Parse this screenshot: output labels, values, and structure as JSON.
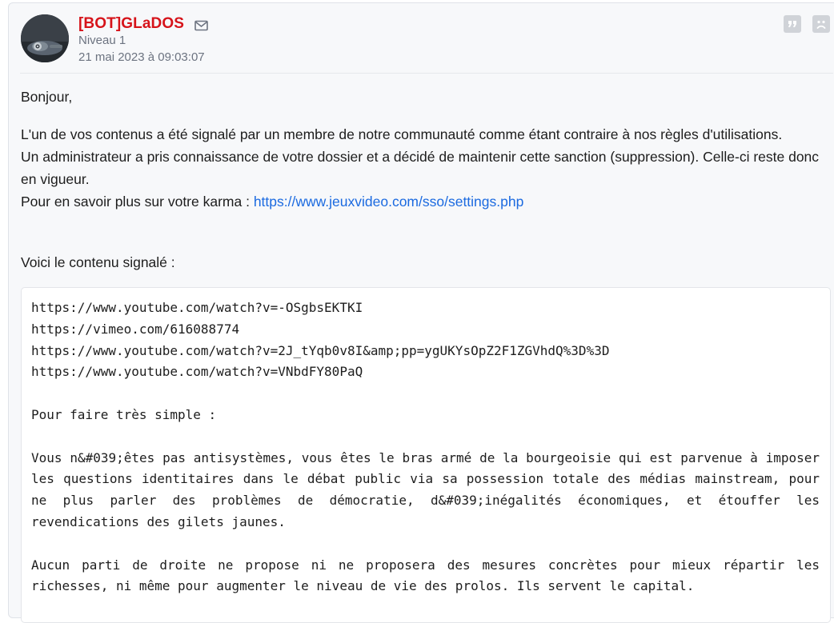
{
  "post": {
    "author": "[BOT]GLaDOS",
    "level": "Niveau 1",
    "date": "21 mai 2023 à 09:03:07",
    "icons": {
      "mail": "envelope-icon",
      "quote": "quote-icon",
      "report": "sad-face-icon"
    },
    "greeting": "Bonjour,",
    "line1": "L'un de vos contenus a été signalé par un membre de notre communauté comme étant contraire à nos règles d'utilisations.",
    "line2": "Un administrateur a pris connaissance de votre dossier et a décidé de maintenir cette sanction (suppression). Celle-ci reste donc en vigueur.",
    "line3_prefix": "Pour en savoir plus sur votre karma : ",
    "karma_link": "https://www.jeuxvideo.com/sso/settings.php",
    "intro": "Voici le contenu signalé :"
  },
  "reported": {
    "links": [
      "https://www.youtube.com/watch?v=-OSgbsEKTKI",
      "https://vimeo.com/616088774",
      "https://www.youtube.com/watch?v=2J_tYqb0v8I&amp;pp=ygUKYsOpZ2F1ZGVhdQ%3D%3D",
      "https://www.youtube.com/watch?v=VNbdFY80PaQ"
    ],
    "para1": "Pour faire très simple :",
    "para2": "Vous n&#039;êtes pas antisystèmes, vous êtes le bras armé de la bourgeoisie qui est parvenue à imposer les questions identitaires dans le débat public via sa possession totale des médias mainstream, pour ne plus parler des problèmes de démocratie, d&#039;inégalités économiques, et étouffer les revendications des gilets jaunes.",
    "para3": "Aucun parti de droite ne propose ni ne proposera des mesures concrètes pour mieux répartir les richesses, ni même pour augmenter le niveau de vie des prolos. Ils servent le capital."
  },
  "colors": {
    "author": "#d6131a",
    "link": "#1b6ae0",
    "meta": "#6c7380"
  }
}
